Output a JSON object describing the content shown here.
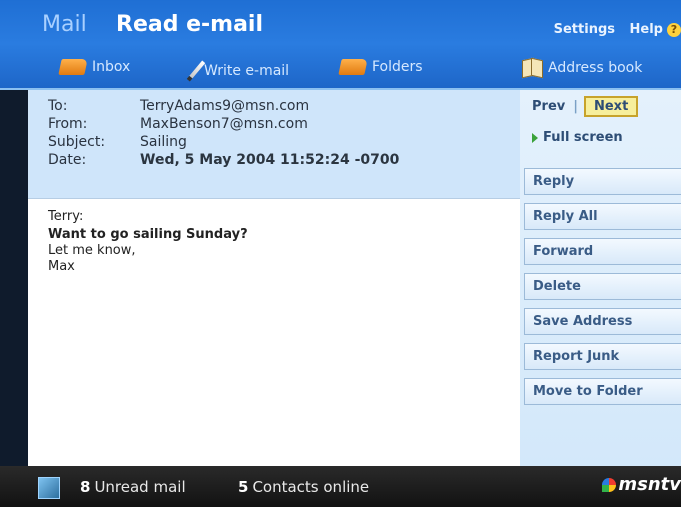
{
  "header": {
    "app_name": "Mail",
    "page_title": "Read e-mail",
    "settings_label": "Settings",
    "help_label": "Help",
    "help_glyph": "?"
  },
  "nav": {
    "inbox": "Inbox",
    "write": "Write e-mail",
    "folders": "Folders",
    "address_book": "Address book"
  },
  "message": {
    "to_label": "To:",
    "to_value": "TerryAdams9@msn.com",
    "from_label": "From:",
    "from_value": "MaxBenson7@msn.com",
    "subject_label": "Subject:",
    "subject_value": "Sailing",
    "date_label": "Date:",
    "date_value": "Wed, 5 May 2004 11:52:24 -0700",
    "body": [
      "Terry:",
      "Want to go sailing Sunday?",
      "Let me know,",
      "Max"
    ]
  },
  "side": {
    "prev": "Prev",
    "separator": "|",
    "next": "Next",
    "full_screen": "Full screen",
    "actions": [
      "Reply",
      "Reply All",
      "Forward",
      "Delete",
      "Save Address",
      "Report Junk",
      "Move to Folder"
    ]
  },
  "status": {
    "unread_count": "8",
    "unread_label": "Unread mail",
    "contacts_count": "5",
    "contacts_label": "Contacts online",
    "logo_text": "msntv"
  },
  "colors": {
    "header_blue": "#2a7ce0",
    "next_highlight": "#f7ef9c",
    "header_pane": "#cfe5fa"
  }
}
